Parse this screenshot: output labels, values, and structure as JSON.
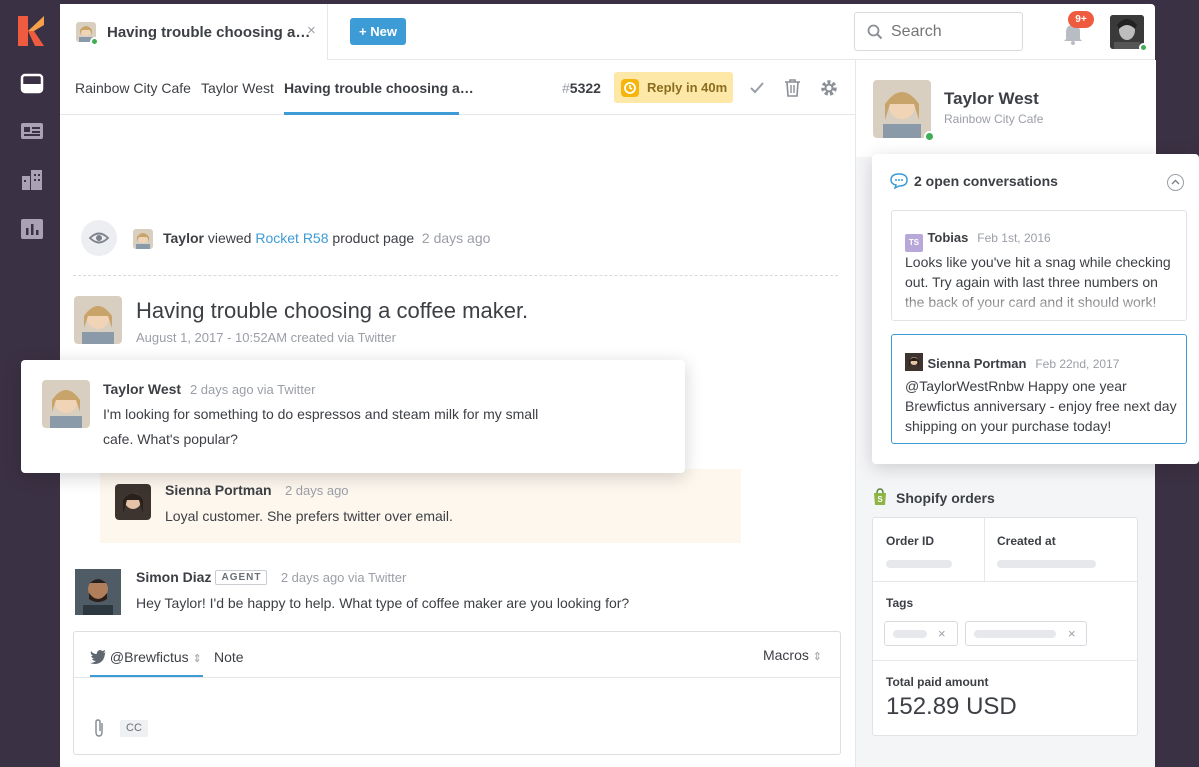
{
  "header": {
    "tab_title": "Having trouble choosing a…",
    "tab_close": "×",
    "new_button": "+ New",
    "search_placeholder": "Search",
    "notification_badge": "9+"
  },
  "breadcrumb": {
    "items": [
      "Rainbow City Cafe",
      "Taylor West",
      "Having trouble choosing a…"
    ],
    "ticket_hash": "#",
    "ticket_number": "5322",
    "reply_sla": "Reply in 40m"
  },
  "event": {
    "actor": "Taylor",
    "verb": "viewed",
    "product": "Rocket R58",
    "object": "product page",
    "time": "2 days ago"
  },
  "conversation": {
    "subject": "Having trouble choosing a coffee maker.",
    "meta": "August 1, 2017 - 10:52AM created via Twitter"
  },
  "messages": [
    {
      "name": "Taylor West",
      "meta": "2 days ago via Twitter",
      "line1": "I'm looking for something to do espressos and steam milk for my small",
      "line2": "cafe. What's popular?"
    },
    {
      "name": "Sienna Portman",
      "meta": "2 days ago",
      "body": "Loyal customer. She prefers twitter over email."
    },
    {
      "name": "Simon Diaz",
      "badge": "AGENT",
      "meta": "2 days ago via Twitter",
      "body": "Hey Taylor! I'd be happy to help. What type of coffee maker are you looking for?"
    }
  ],
  "composer": {
    "channel": "@Brewfictus",
    "note_tab": "Note",
    "macros": "Macros",
    "cc": "CC"
  },
  "customer": {
    "name": "Taylor West",
    "company": "Rainbow City Cafe"
  },
  "open_conversations": {
    "header": "2 open conversations",
    "items": [
      {
        "initials": "TS",
        "author": "Tobias",
        "date": "Feb 1st, 2016",
        "body": "Looks like you've hit a snag while checking out. Try again with last three numbers on the back of your card and it should work!"
      },
      {
        "author": "Sienna Portman",
        "date": "Feb 22nd, 2017",
        "body": "@TaylorWestRnbw Happy one year Brewfictus anniversary - enjoy free next day shipping on your purchase today!"
      }
    ]
  },
  "shopify": {
    "title": "Shopify orders",
    "order_id_label": "Order ID",
    "created_at_label": "Created at",
    "tags_label": "Tags",
    "total_label": "Total paid amount",
    "total_value": "152.89 USD"
  }
}
